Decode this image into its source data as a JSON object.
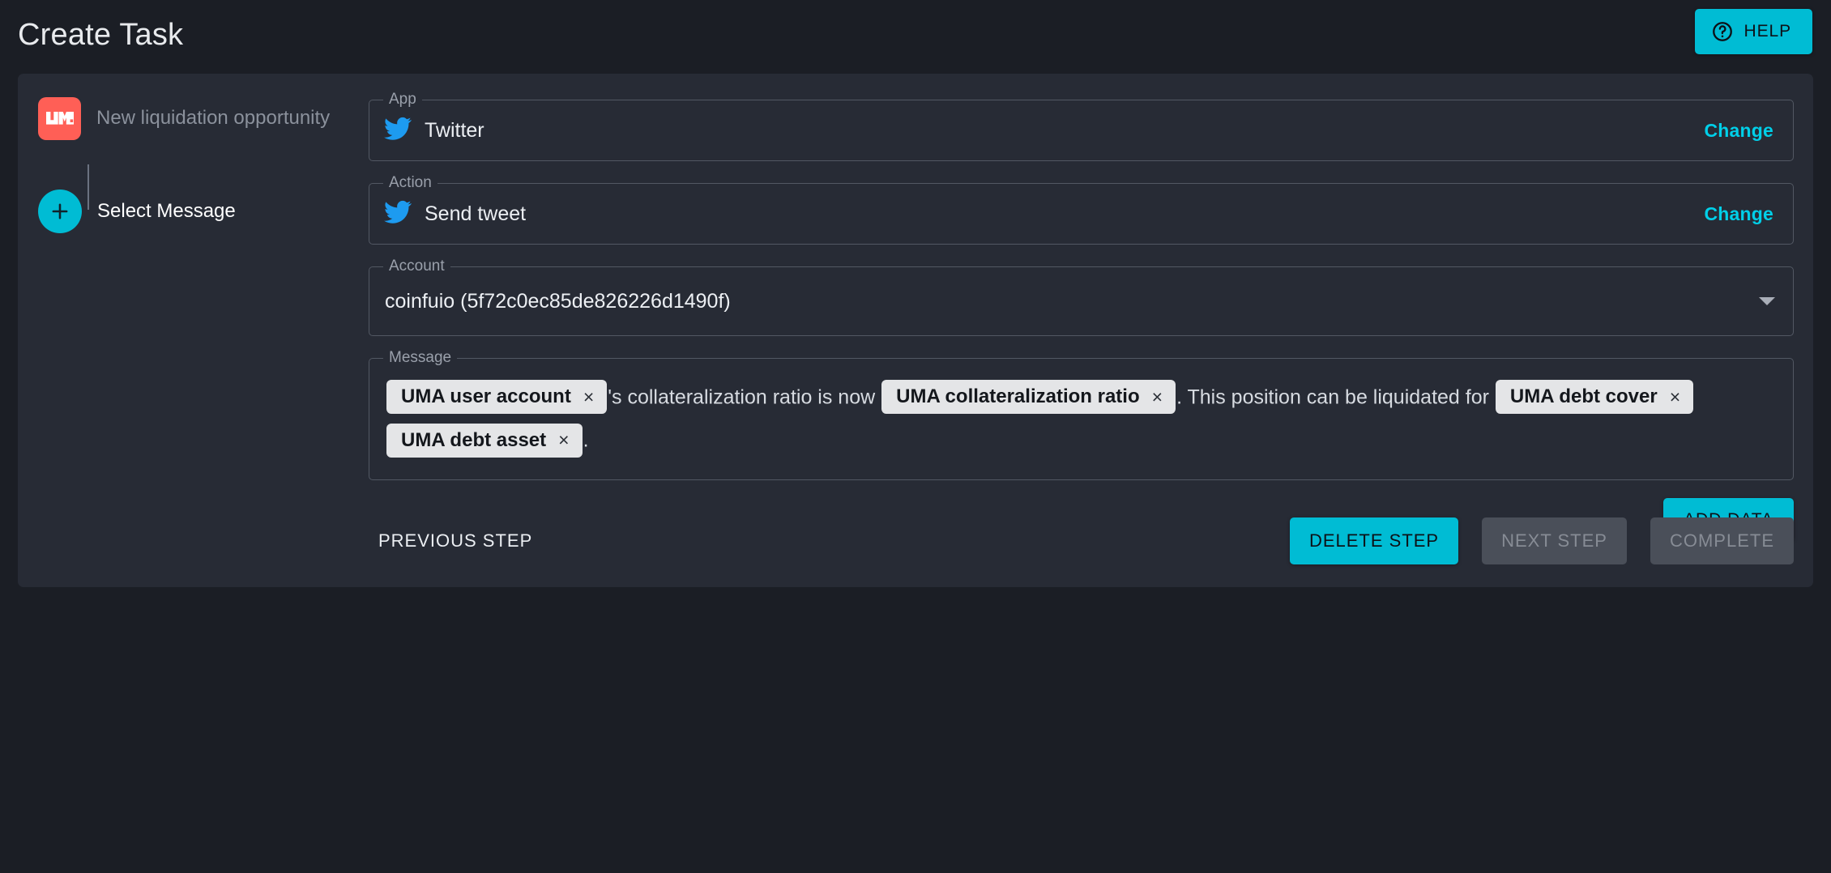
{
  "header": {
    "title": "Create Task",
    "help_label": "HELP",
    "help_icon": "question-circle-icon",
    "accent_color": "#00bcd4"
  },
  "steps": [
    {
      "id": "trigger",
      "label": "New liquidation opportunity",
      "icon": "uma-logo-icon",
      "icon_text": "UMA",
      "icon_color": "#ff5f56",
      "state": "configured"
    },
    {
      "id": "select-message",
      "label": "Select Message",
      "icon": "plus-icon",
      "icon_color": "#00bcd4",
      "state": "active"
    }
  ],
  "form": {
    "app": {
      "legend": "App",
      "value": "Twitter",
      "icon": "twitter-bird-icon",
      "change_label": "Change"
    },
    "action": {
      "legend": "Action",
      "value": "Send tweet",
      "icon": "twitter-bird-icon",
      "change_label": "Change"
    },
    "account": {
      "legend": "Account",
      "value": "coinfuio (5f72c0ec85de826226d1490f)"
    },
    "message": {
      "legend": "Message",
      "tokens": [
        {
          "type": "chip",
          "label": "UMA user account",
          "remove": "×"
        },
        {
          "type": "text",
          "text": "'s collateralization ratio is now "
        },
        {
          "type": "chip",
          "label": "UMA collateralization ratio",
          "remove": "×"
        },
        {
          "type": "text",
          "text": ". This position can be liquidated for "
        },
        {
          "type": "chip",
          "label": "UMA debt cover",
          "remove": "×"
        },
        {
          "type": "chip",
          "label": "UMA debt asset",
          "remove": "×"
        },
        {
          "type": "text",
          "text": "."
        }
      ]
    },
    "add_data_label": "ADD DATA"
  },
  "actions": {
    "previous_label": "PREVIOUS STEP",
    "delete_label": "DELETE STEP",
    "next_label": "NEXT STEP",
    "complete_label": "COMPLETE",
    "next_disabled": true,
    "complete_disabled": true
  }
}
